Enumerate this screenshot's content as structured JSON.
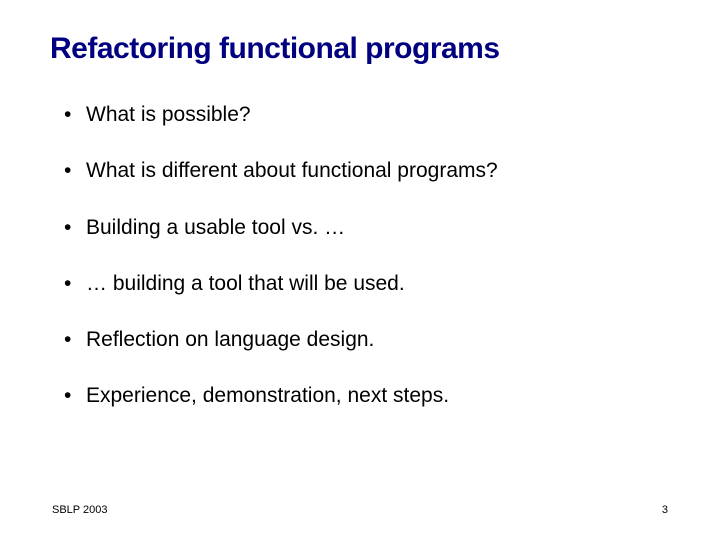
{
  "title": "Refactoring functional programs",
  "bullets": [
    "What is possible?",
    "What is different about functional programs?",
    "Building a usable tool vs. …",
    "… building a tool that will be used.",
    "Reflection on language design.",
    "Experience, demonstration, next steps."
  ],
  "footer": {
    "left": "SBLP 2003",
    "right": "3"
  }
}
